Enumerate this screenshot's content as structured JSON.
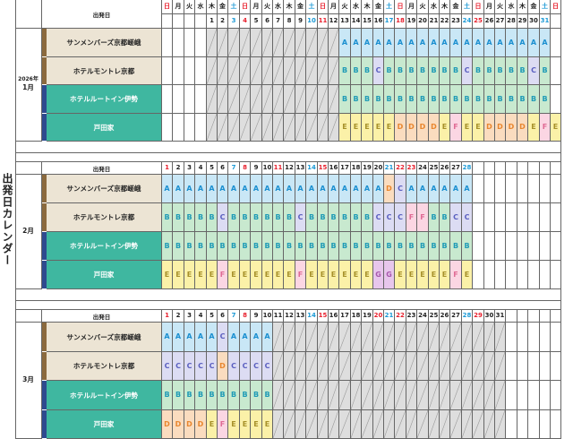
{
  "side_title": "出発日カレンダー",
  "header_label": "出発日",
  "colors": {
    "sun_sat_red": "#e8212e",
    "sat_blue": "#1d9ad6",
    "A": {
      "bg": "#c9e7f6",
      "fg": "#1b8fd0"
    },
    "B": {
      "bg": "#c8e9cf",
      "fg": "#1f9bb6"
    },
    "C": {
      "bg": "#dcdcf3",
      "fg": "#5a5fc0"
    },
    "D": {
      "bg": "#fadcbf",
      "fg": "#e9862e"
    },
    "E": {
      "bg": "#fbf1a8",
      "fg": "#a7912a"
    },
    "F": {
      "bg": "#fbd6e3",
      "fg": "#e06b95"
    },
    "G": {
      "bg": "#e7c6ec",
      "fg": "#a757ad"
    },
    "hotel_green": "#3fb7a0",
    "hotel_tan": "#ece4d4",
    "grey_cell": "#dedede"
  },
  "hotels": [
    "サンメンバーズ京都嵯峨",
    "ホテルモントレ京都",
    "ホテルルートイン伊勢",
    "戸田家"
  ],
  "months": [
    {
      "year": "2026年",
      "label": "1月",
      "weekday_row": [
        "日",
        "月",
        "火",
        "水",
        "木",
        "金",
        "土",
        "日",
        "月",
        "火",
        "水",
        "木",
        "金",
        "土",
        "日",
        "月",
        "火",
        "水",
        "木",
        "金",
        "土",
        "日",
        "月",
        "火",
        "水",
        "木",
        "金",
        "土",
        "日",
        "月",
        "火",
        "水",
        "木",
        "金",
        "土",
        "日"
      ],
      "date_row": [
        "",
        "",
        "",
        "",
        "1",
        "2",
        "3",
        "4",
        "5",
        "6",
        "7",
        "8",
        "9",
        "10",
        "11",
        "12",
        "13",
        "14",
        "15",
        "16",
        "17",
        "18",
        "19",
        "20",
        "21",
        "22",
        "23",
        "24",
        "25",
        "26",
        "27",
        "28",
        "29",
        "30",
        "31",
        ""
      ],
      "rows": [
        [
          "",
          "",
          "",
          "",
          "/",
          "/",
          "/",
          "/",
          "/",
          "/",
          "/",
          "/",
          "/",
          "/",
          "/",
          "/",
          "A",
          "A",
          "A",
          "A",
          "A",
          "A",
          "A",
          "A",
          "A",
          "A",
          "A",
          "A",
          "A",
          "A",
          "A",
          "A",
          "A",
          "A",
          "A",
          ""
        ],
        [
          "",
          "",
          "",
          "",
          "/",
          "/",
          "/",
          "/",
          "/",
          "/",
          "/",
          "/",
          "/",
          "/",
          "/",
          "/",
          "B",
          "B",
          "B",
          "C",
          "B",
          "B",
          "B",
          "B",
          "B",
          "B",
          "B",
          "C",
          "B",
          "B",
          "B",
          "B",
          "B",
          "C",
          "B",
          ""
        ],
        [
          "",
          "",
          "",
          "",
          "/",
          "/",
          "/",
          "/",
          "/",
          "/",
          "/",
          "/",
          "/",
          "/",
          "/",
          "/",
          "B",
          "B",
          "B",
          "B",
          "B",
          "B",
          "B",
          "B",
          "B",
          "B",
          "B",
          "B",
          "B",
          "B",
          "B",
          "B",
          "B",
          "B",
          "B",
          ""
        ],
        [
          "",
          "",
          "",
          "",
          "/",
          "/",
          "/",
          "/",
          "/",
          "/",
          "/",
          "/",
          "/",
          "/",
          "/",
          "/",
          "E",
          "E",
          "E",
          "E",
          "E",
          "D",
          "D",
          "D",
          "D",
          "E",
          "F",
          "E",
          "E",
          "D",
          "D",
          "D",
          "D",
          "E",
          "F",
          "E"
        ]
      ]
    },
    {
      "label": "2月",
      "date_row": [
        "1",
        "2",
        "3",
        "4",
        "5",
        "6",
        "7",
        "8",
        "9",
        "10",
        "11",
        "12",
        "13",
        "14",
        "15",
        "16",
        "17",
        "18",
        "19",
        "20",
        "21",
        "22",
        "23",
        "24",
        "25",
        "26",
        "27",
        "28",
        "",
        "",
        "",
        "",
        "",
        "",
        "",
        ""
      ],
      "rows": [
        [
          "A",
          "A",
          "A",
          "A",
          "A",
          "A",
          "A",
          "A",
          "A",
          "A",
          "A",
          "A",
          "A",
          "A",
          "A",
          "A",
          "A",
          "A",
          "A",
          "A",
          "D",
          "C",
          "A",
          "A",
          "A",
          "A",
          "A",
          "A",
          "",
          "",
          "",
          "",
          "",
          "",
          "",
          ""
        ],
        [
          "B",
          "B",
          "B",
          "B",
          "B",
          "C",
          "B",
          "B",
          "B",
          "B",
          "B",
          "B",
          "C",
          "B",
          "B",
          "B",
          "B",
          "B",
          "B",
          "C",
          "C",
          "C",
          "F",
          "F",
          "B",
          "B",
          "C",
          "C",
          "",
          "",
          "",
          "",
          "",
          "",
          "",
          ""
        ],
        [
          "B",
          "B",
          "B",
          "B",
          "B",
          "B",
          "B",
          "B",
          "B",
          "B",
          "B",
          "B",
          "B",
          "B",
          "B",
          "B",
          "B",
          "B",
          "B",
          "B",
          "B",
          "B",
          "B",
          "B",
          "B",
          "B",
          "B",
          "B",
          "",
          "",
          "",
          "",
          "",
          "",
          "",
          ""
        ],
        [
          "E",
          "E",
          "E",
          "E",
          "E",
          "F",
          "E",
          "E",
          "E",
          "E",
          "E",
          "E",
          "F",
          "E",
          "E",
          "E",
          "E",
          "E",
          "E",
          "G",
          "G",
          "E",
          "E",
          "E",
          "E",
          "E",
          "F",
          "E",
          "",
          "",
          "",
          "",
          "",
          "",
          "",
          ""
        ]
      ]
    },
    {
      "label": "3月",
      "date_row": [
        "1",
        "2",
        "3",
        "4",
        "5",
        "6",
        "7",
        "8",
        "9",
        "10",
        "11",
        "12",
        "13",
        "14",
        "15",
        "16",
        "17",
        "18",
        "19",
        "20",
        "21",
        "22",
        "23",
        "24",
        "25",
        "26",
        "27",
        "28",
        "29",
        "30",
        "31",
        "",
        "",
        "",
        "",
        ""
      ],
      "rows": [
        [
          "A",
          "A",
          "A",
          "A",
          "A",
          "C",
          "A",
          "A",
          "A",
          "A",
          "/",
          "/",
          "/",
          "/",
          "/",
          "/",
          "/",
          "/",
          "/",
          "/",
          "/",
          "/",
          "/",
          "/",
          "/",
          "/",
          "/",
          "/",
          "/",
          "/",
          "/",
          "",
          "",
          "",
          "",
          ""
        ],
        [
          "C",
          "C",
          "C",
          "C",
          "C",
          "D",
          "C",
          "C",
          "C",
          "C",
          "/",
          "/",
          "/",
          "/",
          "/",
          "/",
          "/",
          "/",
          "/",
          "/",
          "/",
          "/",
          "/",
          "/",
          "/",
          "/",
          "/",
          "/",
          "/",
          "/",
          "/",
          "",
          "",
          "",
          "",
          ""
        ],
        [
          "B",
          "B",
          "B",
          "B",
          "B",
          "B",
          "B",
          "B",
          "B",
          "B",
          "/",
          "/",
          "/",
          "/",
          "/",
          "/",
          "/",
          "/",
          "/",
          "/",
          "/",
          "/",
          "/",
          "/",
          "/",
          "/",
          "/",
          "/",
          "/",
          "/",
          "/",
          "",
          "",
          "",
          "",
          ""
        ],
        [
          "D",
          "D",
          "D",
          "D",
          "E",
          "F",
          "E",
          "E",
          "E",
          "E",
          "/",
          "/",
          "/",
          "/",
          "/",
          "/",
          "/",
          "/",
          "/",
          "/",
          "/",
          "/",
          "/",
          "/",
          "/",
          "/",
          "/",
          "/",
          "/",
          "/",
          "/",
          "",
          "",
          "",
          "",
          ""
        ]
      ]
    }
  ]
}
